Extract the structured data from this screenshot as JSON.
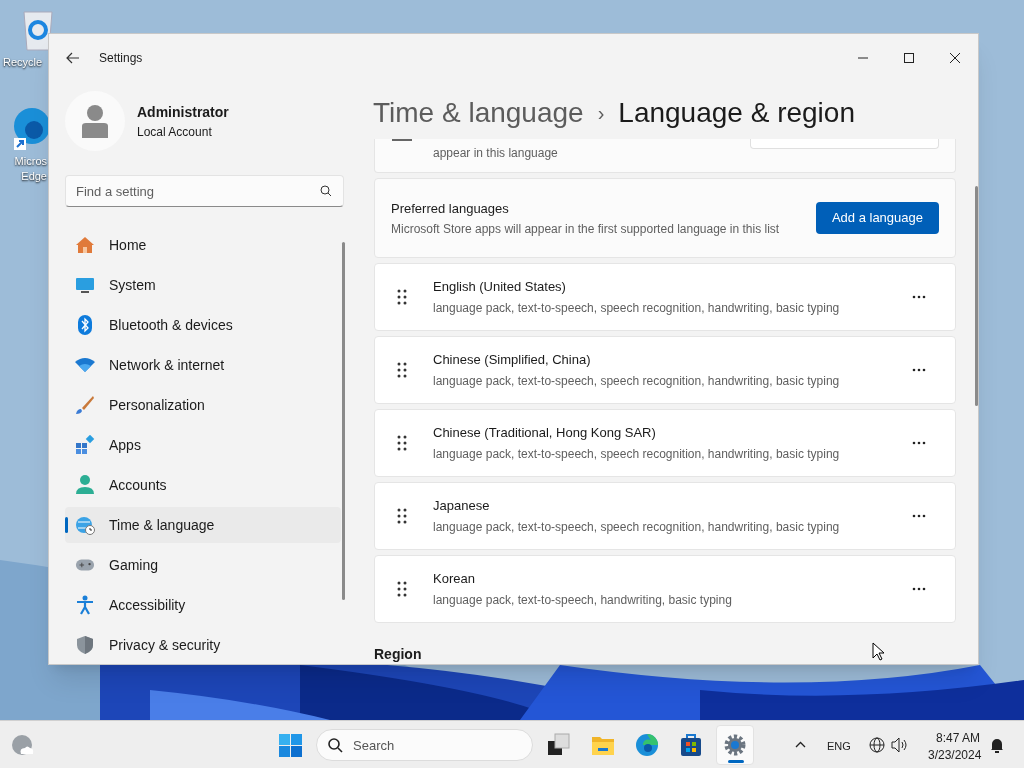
{
  "desktop_icons": [
    {
      "label": "Recycle"
    },
    {
      "label": "Micros Edge"
    }
  ],
  "window": {
    "title": "Settings"
  },
  "account": {
    "name": "Administrator",
    "type": "Local Account"
  },
  "search": {
    "placeholder": "Find a setting"
  },
  "nav_items": [
    {
      "label": "Home",
      "selected": false
    },
    {
      "label": "System",
      "selected": false
    },
    {
      "label": "Bluetooth & devices",
      "selected": false
    },
    {
      "label": "Network & internet",
      "selected": false
    },
    {
      "label": "Personalization",
      "selected": false
    },
    {
      "label": "Apps",
      "selected": false
    },
    {
      "label": "Accounts",
      "selected": false
    },
    {
      "label": "Time & language",
      "selected": true
    },
    {
      "label": "Gaming",
      "selected": false
    },
    {
      "label": "Accessibility",
      "selected": false
    },
    {
      "label": "Privacy & security",
      "selected": false
    }
  ],
  "breadcrumb": {
    "parent": "Time & language",
    "separator": "›",
    "current": "Language & region"
  },
  "partial_card": {
    "description": "appear in this language"
  },
  "preferred_languages": {
    "title": "Preferred languages",
    "description": "Microsoft Store apps will appear in the first supported language in this list",
    "button": "Add a language"
  },
  "languages": [
    {
      "name": "English (United States)",
      "features": "language pack, text-to-speech, speech recognition, handwriting, basic typing"
    },
    {
      "name": "Chinese (Simplified, China)",
      "features": "language pack, text-to-speech, speech recognition, handwriting, basic typing"
    },
    {
      "name": "Chinese (Traditional, Hong Kong SAR)",
      "features": "language pack, text-to-speech, speech recognition, handwriting, basic typing"
    },
    {
      "name": "Japanese",
      "features": "language pack, text-to-speech, speech recognition, handwriting, basic typing"
    },
    {
      "name": "Korean",
      "features": "language pack, text-to-speech, handwriting, basic typing"
    }
  ],
  "section_heading": "Region",
  "taskbar": {
    "search_placeholder": "Search",
    "apps": [
      {
        "selected": false
      },
      {
        "selected": false
      },
      {
        "selected": false
      },
      {
        "selected": false
      },
      {
        "selected": true
      }
    ],
    "language": "ENG",
    "time": "8:47 AM",
    "date": "3/23/2024"
  }
}
